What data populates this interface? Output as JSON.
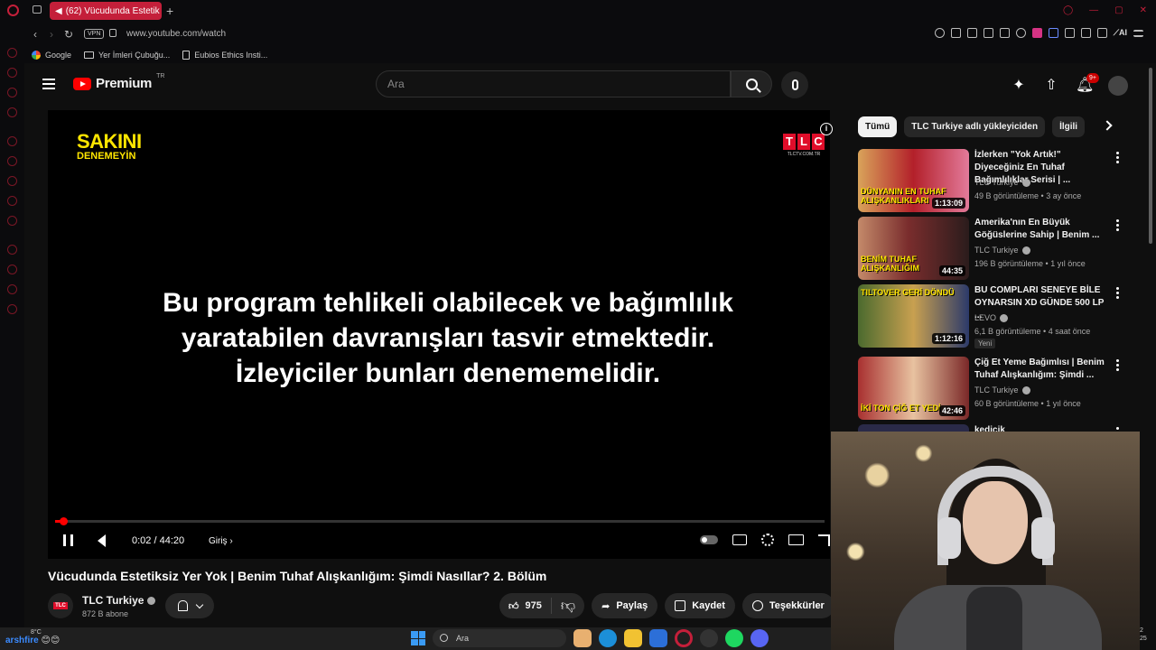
{
  "browser": {
    "tab_title": "(62) Vücudunda Estetik",
    "url": "www.youtube.com/watch",
    "vpn_label": "VPN",
    "bookmarks": [
      "Google",
      "Yer İmleri Çubuğu...",
      "Eubios Ethics Insti..."
    ]
  },
  "youtube": {
    "brand": "Premium",
    "region": "TR",
    "search_placeholder": "Ara",
    "notification_count": "9+"
  },
  "player": {
    "logo_line1": "SAKINI",
    "logo_line2": "DENEMEYİN",
    "channel_logo": [
      "T",
      "L",
      "C"
    ],
    "channel_logo_url": "TLCTV.COM.TR",
    "warning_text": [
      "Bu program tehlikeli olabilecek ve bağımlılık",
      "yaratabilen davranışları tasvir etmektedir.",
      "İzleyiciler bunları denememelidir."
    ],
    "time": "0:02 / 44:20",
    "chapter": "Giriş",
    "progress": 0.01
  },
  "video": {
    "title": "Vücudunda Estetiksiz Yer Yok | Benim Tuhaf Alışkanlığım: Şimdi Nasıllar? 2. Bölüm",
    "channel": "TLC Turkiye",
    "subscribers": "872 B abone",
    "likes": "975",
    "share": "Paylaş",
    "save": "Kaydet",
    "thanks": "Teşekkürler"
  },
  "chips": [
    "Tümü",
    "TLC Turkiye adlı yükleyiciden",
    "İlgili"
  ],
  "recommendations": [
    {
      "title": "İzlerken \"Yok Artık!\" Diyeceğiniz En Tuhaf Bağımlılıklar Serisi | ...",
      "channel": "TLC Turkiye",
      "meta": "49 B görüntüleme • 3 ay önce",
      "duration": "1:13:09",
      "thumb_text": "DÜNYANIN EN TUHAF ALIŞKANLIKLARI",
      "new": ""
    },
    {
      "title": "Amerika'nın En Büyük Göğüslerine Sahip | Benim ...",
      "channel": "TLC Turkiye",
      "meta": "196 B görüntüleme • 1 yıl önce",
      "duration": "44:35",
      "thumb_text": "BENİM TUHAF ALIŞKANLIĞIM",
      "new": ""
    },
    {
      "title": "BU COMPLARI SENEYE BİLE OYNARSIN XD GÜNDE 500 LP ...",
      "channel": "LEVO",
      "meta": "6,1 B görüntüleme • 4 saat önce",
      "duration": "1:12:16",
      "thumb_text": "TILTOVER GERİ DÖNDÜ",
      "new": "Yeni"
    },
    {
      "title": "Çiğ Et Yeme Bağımlısı | Benim Tuhaf Alışkanlığım: Şimdi ...",
      "channel": "TLC Turkiye",
      "meta": "60 B görüntüleme • 1 yıl önce",
      "duration": "42:46",
      "thumb_text": "İKİ TON ÇİĞ ET YEDİ",
      "new": ""
    },
    {
      "title": "kedicik",
      "channel": "",
      "meta": "",
      "duration": "",
      "thumb_text": "",
      "new": ""
    }
  ],
  "taskbar": {
    "weather": "8°C",
    "user": "arshfire",
    "search": "Ara",
    "clock_top": "2",
    "clock_bottom": "25"
  },
  "colors": {
    "accent_red": "#ff0000",
    "opera_red": "#c41f3a",
    "yellow_logo": "#ffe600"
  }
}
